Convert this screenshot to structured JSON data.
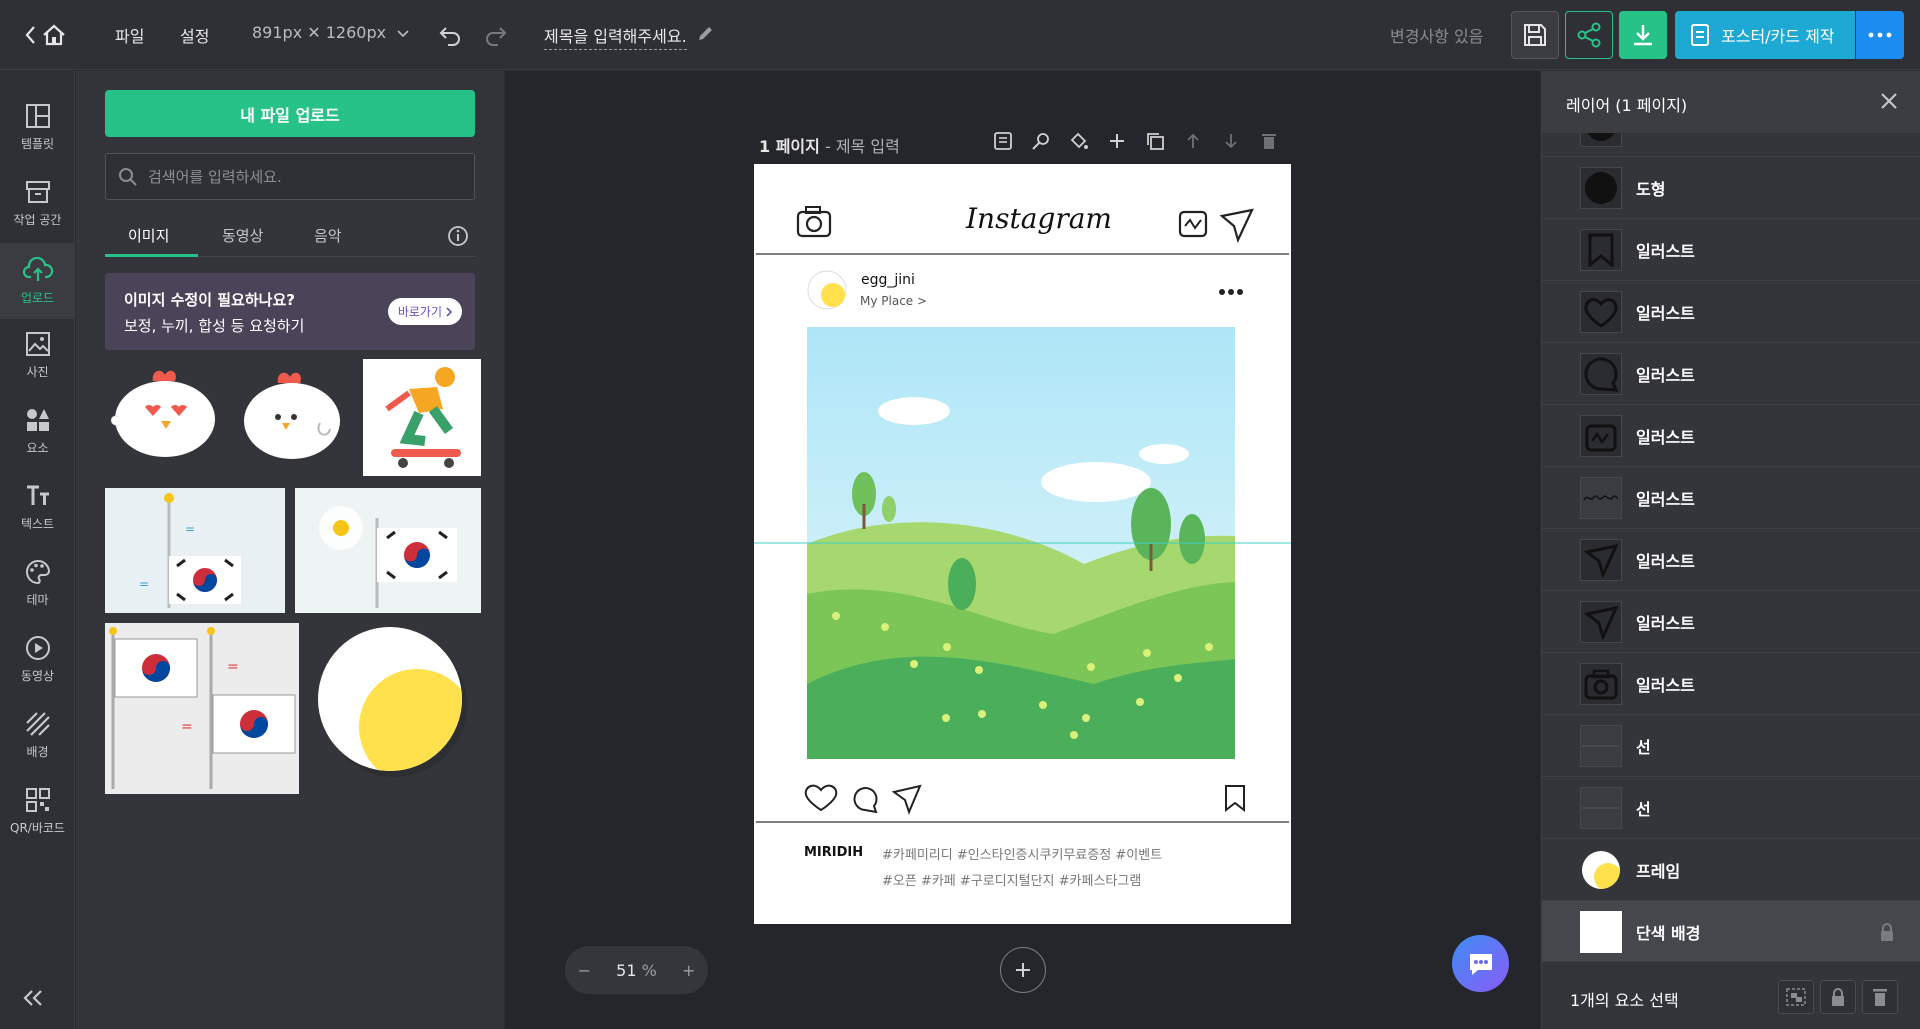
{
  "topbar": {
    "menu_file": "파일",
    "menu_settings": "설정",
    "size": "891px ✕ 1260px",
    "doc_title": "제목을 입력해주세요.",
    "status": "변경사항 있음",
    "make_label": "포스터/카드 제작"
  },
  "rail": {
    "items": [
      "템플릿",
      "작업 공간",
      "업로드",
      "사진",
      "요소",
      "텍스트",
      "테마",
      "동영상",
      "배경",
      "QR/바코드"
    ]
  },
  "panel": {
    "upload_label": "내 파일 업로드",
    "search_placeholder": "검색어를 입력하세요.",
    "tabs": [
      "이미지",
      "동영상",
      "음악"
    ],
    "promo_title": "이미지 수정이 필요하나요?",
    "promo_sub": "보정, 누끼, 합성 등 요청하기",
    "promo_button": "바로가기"
  },
  "canvas": {
    "page_number": "1 페이지",
    "page_sep": " - ",
    "page_name": "제목 입력",
    "zoom_value": "51",
    "zoom_unit": "%"
  },
  "post": {
    "brand": "Instagram",
    "username": "egg_jini",
    "place": "My Place >",
    "caption_user": "MIRIDIH",
    "caption_line1": "#카페미리디 #인스타인증시쿠키무료증정 #이벤트",
    "caption_line2": "#오픈 #카페 #구로디지털단지 #카페스타그램"
  },
  "layers": {
    "title": "레이어 (1 페이지)",
    "items": [
      "도형",
      "일러스트",
      "일러스트",
      "일러스트",
      "일러스트",
      "일러스트",
      "일러스트",
      "일러스트",
      "일러스트",
      "선",
      "선",
      "프레임",
      "단색 배경"
    ],
    "footer": "1개의 요소 선택"
  },
  "colors": {
    "accent": "#27c287",
    "brand_blue": "#1ea9d4",
    "promo_bg": "#4b4358"
  }
}
